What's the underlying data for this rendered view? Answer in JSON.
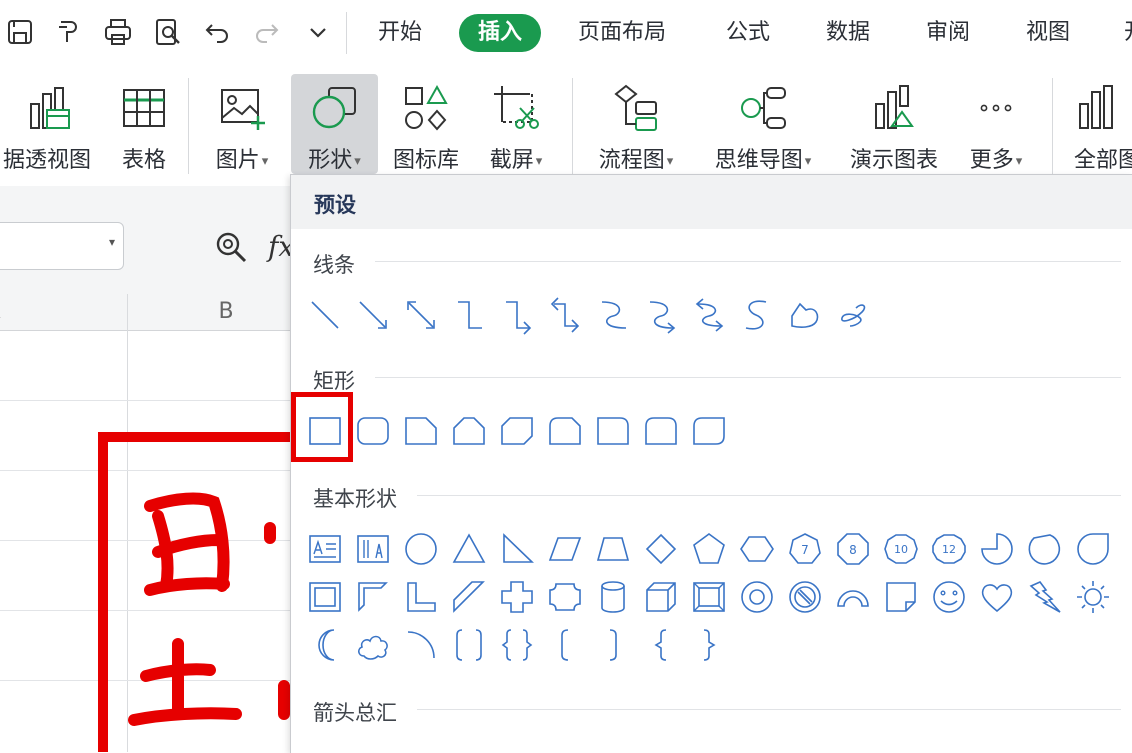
{
  "menu": {
    "tabs": [
      "开始",
      "插入",
      "页面布局",
      "公式",
      "数据",
      "审阅",
      "视图",
      "开"
    ],
    "active": "插入"
  },
  "quick_access": [
    "save-icon",
    "format-painter-icon",
    "print-icon",
    "print-preview-icon",
    "undo-icon",
    "redo-icon",
    "more-dropdown-icon"
  ],
  "ribbon": {
    "pivot_label": "据透视图",
    "table_label": "表格",
    "picture_label": "图片",
    "shape_label": "形状",
    "icon_library_label": "图标库",
    "screenshot_label": "截屏",
    "flowchart_label": "流程图",
    "mindmap_label": "思维导图",
    "demo_chart_label": "演示图表",
    "more_label": "更多",
    "all_label": "全部图",
    "dropdown_arrow": "▾"
  },
  "formula_bar": {
    "fx": "fx",
    "dropdown_arrow": "▾"
  },
  "sheet": {
    "columns": [
      "A",
      "B"
    ]
  },
  "shape_panel": {
    "title": "预设",
    "sections": {
      "lines": "线条",
      "rectangles": "矩形",
      "basic": "基本形状",
      "arrows": "箭头总汇"
    },
    "badge_numbers": [
      "7",
      "8",
      "10",
      "12"
    ]
  },
  "colors": {
    "accent": "#1a9a4f",
    "shape_stroke": "#3a74c6",
    "highlight": "#e60000"
  }
}
